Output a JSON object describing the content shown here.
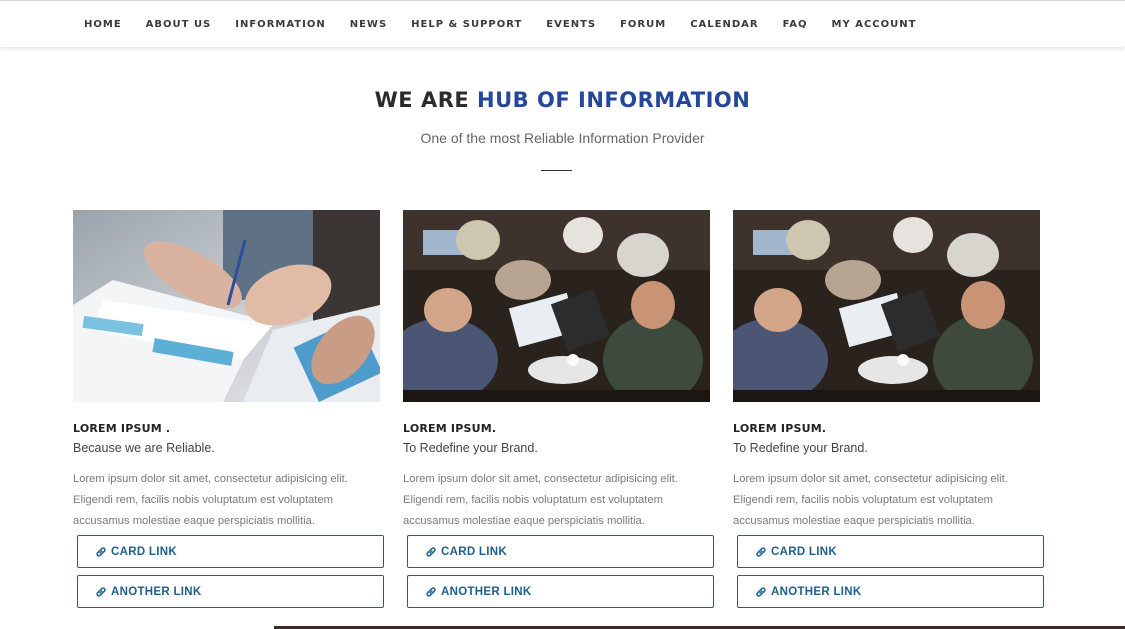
{
  "nav": {
    "items": [
      "HOME",
      "ABOUT US",
      "INFORMATION",
      "NEWS",
      "HELP & SUPPORT",
      "EVENTS",
      "FORUM",
      "CALENDAR",
      "FAQ",
      "MY ACCOUNT"
    ]
  },
  "hero": {
    "title_prefix": "WE ARE",
    "title_accent": "HUB OF INFORMATION",
    "subtitle": "One of the most Reliable Information Provider"
  },
  "cards": [
    {
      "title": "LOREM IPSUM .",
      "tagline": "Because we are Reliable.",
      "text": "Lorem ipsum dolor sit amet, consectetur adipisicing elit. Eligendi rem, facilis nobis voluptatum est voluptatem accusamus molestiae eaque perspiciatis mollitia.",
      "link1": "CARD LINK",
      "link2": "ANOTHER LINK",
      "image": "documents-photo"
    },
    {
      "title": "LOREM IPSUM.",
      "tagline": "To Redefine your Brand.",
      "text": "Lorem ipsum dolor sit amet, consectetur adipisicing elit. Eligendi rem, facilis nobis voluptatum est voluptatem accusamus molestiae eaque perspiciatis mollitia.",
      "link1": "CARD LINK",
      "link2": "ANOTHER LINK",
      "image": "conference-photo"
    },
    {
      "title": "LOREM IPSUM.",
      "tagline": "To Redefine your Brand.",
      "text": "Lorem ipsum dolor sit amet, consectetur adipisicing elit. Eligendi rem, facilis nobis voluptatum est voluptatem accusamus molestiae eaque perspiciatis mollitia.",
      "link1": "CARD LINK",
      "link2": "ANOTHER LINK",
      "image": "conference-photo"
    }
  ],
  "icons": {
    "link": "link-icon"
  },
  "colors": {
    "accent": "#24479b",
    "link": "#1f5f8b",
    "body_text": "#7a7a7a"
  }
}
